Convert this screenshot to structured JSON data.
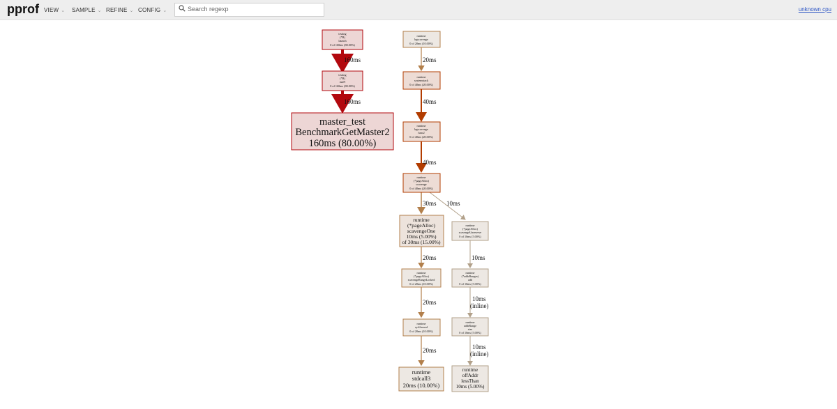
{
  "app": {
    "logo": "pprof",
    "account_link": "unknown cpu"
  },
  "menu": [
    {
      "label": "VIEW"
    },
    {
      "label": "SAMPLE"
    },
    {
      "label": "REFINE"
    },
    {
      "label": "CONFIG"
    }
  ],
  "search": {
    "placeholder": "Search regexp",
    "value": ""
  },
  "graph": {
    "nodes": {
      "testing_launch": {
        "lines": [
          "testing",
          "(*B)",
          "launch",
          "0 of 160ms (80.00%)"
        ]
      },
      "testing_runN": {
        "lines": [
          "testing",
          "(*B)",
          "runN",
          "0 of 160ms (80.00%)"
        ]
      },
      "master_test": {
        "lines": [
          "master_test",
          "BenchmarkGetMaster2",
          "160ms (80.00%)"
        ]
      },
      "bgscavenge": {
        "lines": [
          "runtime",
          "bgscavenge",
          "0 of 20ms (10.00%)"
        ]
      },
      "systemstack": {
        "lines": [
          "runtime",
          "systemstack",
          "0 of 40ms (20.00%)"
        ]
      },
      "bgscavenge_func2": {
        "lines": [
          "runtime",
          "bgscavenge",
          "func2",
          "0 of 40ms (20.00%)"
        ]
      },
      "scavenge": {
        "lines": [
          "runtime",
          "(*pageAlloc)",
          "scavenge",
          "0 of 40ms (20.00%)"
        ]
      },
      "scavengeOne": {
        "lines": [
          "runtime",
          "(*pageAlloc)",
          "scavengeOne",
          "10ms (5.00%)",
          "of 30ms (15.00%)"
        ]
      },
      "scavengeUnreserve": {
        "lines": [
          "runtime",
          "(*pageAlloc)",
          "scavengeUnreserve",
          "0 of 10ms (5.00%)"
        ]
      },
      "scavengeRangeLocked": {
        "lines": [
          "runtime",
          "(*pageAlloc)",
          "scavengeRangeLocked",
          "0 of 20ms (10.00%)"
        ]
      },
      "addrRanges_add": {
        "lines": [
          "runtime",
          "(*addrRanges)",
          "add",
          "0 of 10ms (5.00%)"
        ]
      },
      "sysUnused": {
        "lines": [
          "runtime",
          "sysUnused",
          "0 of 20ms (10.00%)"
        ]
      },
      "addrRange_size": {
        "lines": [
          "runtime",
          "addrRange",
          "size",
          "0 of 10ms (5.00%)"
        ]
      },
      "stdcall3": {
        "lines": [
          "runtime",
          "stdcall3",
          "20ms (10.00%)"
        ]
      },
      "offAddr_lessThan": {
        "lines": [
          "runtime",
          "offAddr",
          "lessThan",
          "10ms (5.00%)"
        ]
      }
    },
    "edges": {
      "launch_runN": {
        "label": "160ms"
      },
      "runN_master": {
        "label": "160ms"
      },
      "bgscavenge_systemstack": {
        "label": "20ms"
      },
      "systemstack_func2": {
        "label": "40ms"
      },
      "func2_scavenge": {
        "label": "40ms"
      },
      "scavenge_scavengeOne": {
        "label": "30ms"
      },
      "scavenge_unreserve": {
        "label": "10ms"
      },
      "scavengeOne_rangeLocked": {
        "label": "20ms"
      },
      "unreserve_add": {
        "label": "10ms"
      },
      "rangeLocked_sysUnused": {
        "label": "20ms"
      },
      "add_size": {
        "lines": [
          "10ms",
          "(inline)"
        ]
      },
      "sysUnused_stdcall3": {
        "label": "20ms"
      },
      "size_lessThan": {
        "lines": [
          "10ms",
          "(inline)"
        ]
      }
    },
    "colors": {
      "hot_fill": "#edd6d5",
      "hot_stroke": "#b2080e",
      "warm_fill": "#eddcd5",
      "warm_stroke": "#b23c00",
      "mid_fill": "#ede3dc",
      "mid_stroke": "#b27f4b",
      "cool_fill": "#ede8e3",
      "cool_stroke": "#b2a18a"
    }
  }
}
